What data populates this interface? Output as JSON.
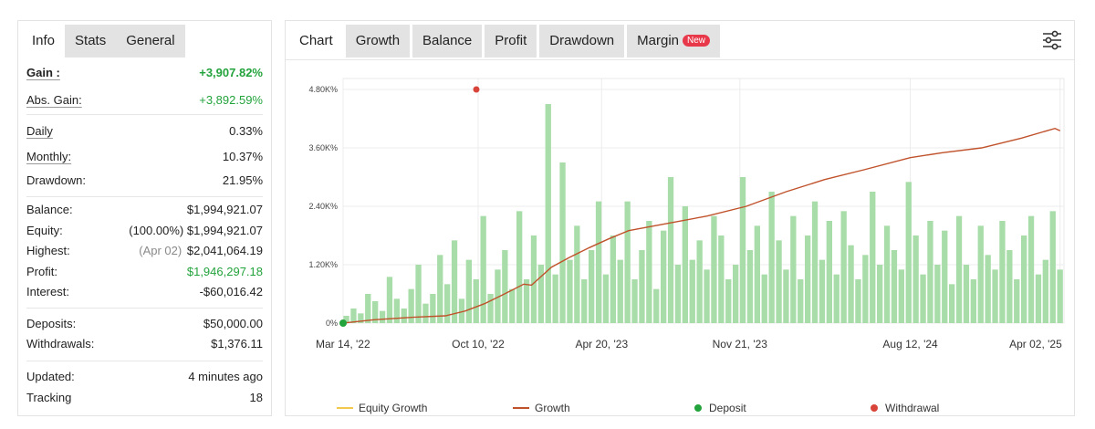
{
  "left_tabs": [
    "Info",
    "Stats",
    "General"
  ],
  "stats": {
    "gain": {
      "label": "Gain :",
      "value": "+3,907.82%"
    },
    "abs_gain": {
      "label": "Abs. Gain:",
      "value": "+3,892.59%"
    },
    "daily": {
      "label": "Daily",
      "value": "0.33%"
    },
    "monthly": {
      "label": "Monthly:",
      "value": "10.37%"
    },
    "drawdown": {
      "label": "Drawdown:",
      "value": "21.95%"
    },
    "balance": {
      "label": "Balance:",
      "value": "$1,994,921.07"
    },
    "equity": {
      "label": "Equity:",
      "pct": "(100.00%)",
      "value": "$1,994,921.07"
    },
    "highest": {
      "label": "Highest:",
      "date": "(Apr 02)",
      "value": "$2,041,064.19"
    },
    "profit": {
      "label": "Profit:",
      "value": "$1,946,297.18"
    },
    "interest": {
      "label": "Interest:",
      "value": "-$60,016.42"
    },
    "deposits": {
      "label": "Deposits:",
      "value": "$50,000.00"
    },
    "withdrawals": {
      "label": "Withdrawals:",
      "value": "$1,376.11"
    },
    "updated": {
      "label": "Updated:",
      "value": "4 minutes ago"
    },
    "tracking": {
      "label": "Tracking",
      "value": "18"
    }
  },
  "chart_tabs": {
    "chart": "Chart",
    "growth": "Growth",
    "balance": "Balance",
    "profit": "Profit",
    "drawdown": "Drawdown",
    "margin": "Margin",
    "margin_badge": "New"
  },
  "icons": {
    "settings": "sliders-icon"
  },
  "colors": {
    "gain_green": "#23a33c",
    "growth_line": "#c0522b",
    "equity_line": "#f2c94c",
    "bars": "#a8dca8",
    "deposit": "#23a33c",
    "withdrawal": "#d9443a",
    "badge": "#e8394a"
  },
  "chart_data": {
    "type": "line",
    "y_tick_labels": [
      "0%",
      "1.20K%",
      "2.40K%",
      "3.60K%",
      "4.80K%"
    ],
    "y_ticks": [
      0,
      1200,
      2400,
      3600,
      4800
    ],
    "ylim": [
      0,
      4950
    ],
    "x_tick_labels": [
      "Mar 14, '22",
      "Oct 10, '22",
      "Apr 20, '23",
      "Nov 21, '23",
      "Aug 12, '24",
      "Apr 02, '25"
    ],
    "x_ticks": [
      "2022-03-14",
      "2022-10-10",
      "2023-04-20",
      "2023-11-21",
      "2024-08-12",
      "2025-04-02"
    ],
    "xlim": [
      "2022-03-14",
      "2025-04-08"
    ],
    "grid": true,
    "legend_position": "bottom",
    "legend": [
      "Equity Growth",
      "Growth",
      "Deposit",
      "Withdrawal"
    ],
    "series": [
      {
        "name": "Growth",
        "kind": "line",
        "points": [
          [
            "2022-03-14",
            0
          ],
          [
            "2022-05-01",
            70
          ],
          [
            "2022-07-01",
            120
          ],
          [
            "2022-08-20",
            150
          ],
          [
            "2022-09-20",
            250
          ],
          [
            "2022-10-20",
            400
          ],
          [
            "2022-11-20",
            600
          ],
          [
            "2022-12-20",
            800
          ],
          [
            "2023-01-01",
            780
          ],
          [
            "2023-02-01",
            1150
          ],
          [
            "2023-03-01",
            1350
          ],
          [
            "2023-04-01",
            1550
          ],
          [
            "2023-05-01",
            1730
          ],
          [
            "2023-06-01",
            1900
          ],
          [
            "2023-08-01",
            2050
          ],
          [
            "2023-10-01",
            2200
          ],
          [
            "2023-12-01",
            2400
          ],
          [
            "2024-02-01",
            2700
          ],
          [
            "2024-04-01",
            2950
          ],
          [
            "2024-06-01",
            3150
          ],
          [
            "2024-08-12",
            3400
          ],
          [
            "2024-10-01",
            3500
          ],
          [
            "2024-12-01",
            3600
          ],
          [
            "2025-02-01",
            3800
          ],
          [
            "2025-03-25",
            4000
          ],
          [
            "2025-04-02",
            3950
          ]
        ]
      },
      {
        "name": "Equity Growth",
        "kind": "bars",
        "values": [
          150,
          300,
          200,
          600,
          450,
          250,
          950,
          500,
          300,
          700,
          1200,
          400,
          600,
          1400,
          800,
          1700,
          500,
          1300,
          900,
          2200,
          600,
          1100,
          1500,
          700,
          2300,
          900,
          1800,
          1200,
          4500,
          1000,
          3300,
          1300,
          2000,
          900,
          1500,
          2500,
          1000,
          1800,
          1300,
          2500,
          900,
          1500,
          2100,
          700,
          1900,
          3000,
          1200,
          2400,
          1300,
          1700,
          1100,
          2200,
          1800,
          900,
          1200,
          3000,
          1500,
          2000,
          1000,
          2700,
          1700,
          1100,
          2200,
          900,
          1800,
          2500,
          1300,
          2100,
          1000,
          2300,
          1600,
          900,
          1400,
          2700,
          1200,
          2000,
          1500,
          1100,
          2900,
          1800,
          1000,
          2100,
          1200,
          1900,
          800,
          2200,
          1200,
          900,
          2000,
          1400,
          1100,
          2100,
          1500,
          900,
          1800,
          2200,
          1000,
          1300,
          2300,
          1100
        ]
      },
      {
        "name": "Deposit",
        "kind": "point",
        "x": "2022-03-14",
        "y": 0
      },
      {
        "name": "Withdrawal",
        "kind": "point",
        "x": "2022-10-10",
        "y": 4800
      }
    ]
  }
}
